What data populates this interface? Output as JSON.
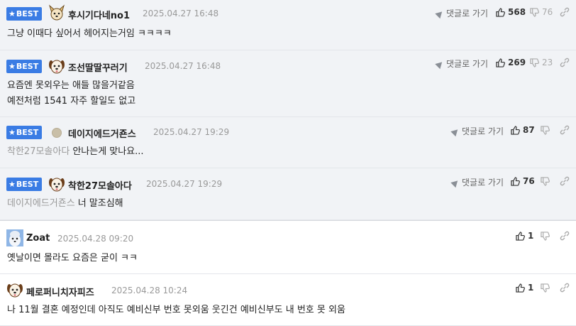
{
  "badge_label": "BEST",
  "reply_label": "댓글로 가기",
  "comments": [
    {
      "nick": "후시기다네no1",
      "date": "2025.04.27 16:48",
      "likes": "568",
      "dislikes": "76",
      "lines": [
        "그냥 이때다 싶어서 헤어지는거임 ㅋㅋㅋㅋ"
      ]
    },
    {
      "nick": "조선딸딸꾸러기",
      "date": "2025.04.27 16:48",
      "likes": "269",
      "dislikes": "23",
      "lines": [
        "요즘엔 못외우는 애들 많을거같음",
        "예전처럼 1541 자주 할일도 없고"
      ]
    },
    {
      "nick": "데이지에드거죤스",
      "date": "2025.04.27 19:29",
      "likes": "87",
      "mention": "착한27모솔아다",
      "lines": [
        "안나는게 맞나요..."
      ]
    },
    {
      "nick": "착한27모솔아다",
      "date": "2025.04.27 19:29",
      "likes": "76",
      "mention": "데이지에드거죤스",
      "lines": [
        "너 말조심해"
      ]
    },
    {
      "nick": "Zoat",
      "date": "2025.04.28 09:20",
      "likes": "1",
      "lines": [
        "옛날이면 몰라도 요즘은 굳이 ㅋㅋ"
      ]
    },
    {
      "nick": "페로퍼니치자피즈",
      "date": "2025.04.28 10:24",
      "likes": "1",
      "lines": [
        "나 11월 결혼 예정인데 아직도 예비신부 번호 못외움 웃긴건 예비신부도 내 번호 못 외움"
      ]
    }
  ],
  "colors": {
    "best_badge": "#3a7ce4",
    "best_background": "#f1f3f6",
    "muted_text": "#999999"
  },
  "icons": [
    "star-icon",
    "reply-arrow-icon",
    "thumbs-up-icon",
    "thumbs-down-icon",
    "link-icon"
  ]
}
